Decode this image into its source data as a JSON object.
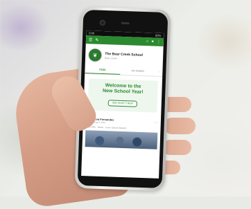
{
  "status_bar": {
    "time": "8:00",
    "battery": "80%"
  },
  "app_bar": {
    "menu_icon": "menu-icon",
    "edit_icon": "pencil-icon",
    "search_icon": "search-icon",
    "notif_icon": "bell-icon",
    "more_icon": "more-icon"
  },
  "school": {
    "name": "The Bear Creek School",
    "subtitle": "Bear Creek"
  },
  "tabs": [
    {
      "label": "FEED"
    },
    {
      "label": "MY PAGES"
    }
  ],
  "welcome": {
    "title_line1": "Welcome to the",
    "title_line2": "New School Year!",
    "button_label": "SEE WHAT'S NEW"
  },
  "post": {
    "author": "Eva Fernandez",
    "date": "Aug 8, 2019",
    "meta": "2019-2020 · Status · Lower School Students",
    "avatar_initial": "E"
  },
  "colors": {
    "brand": "#2b8a2f"
  }
}
